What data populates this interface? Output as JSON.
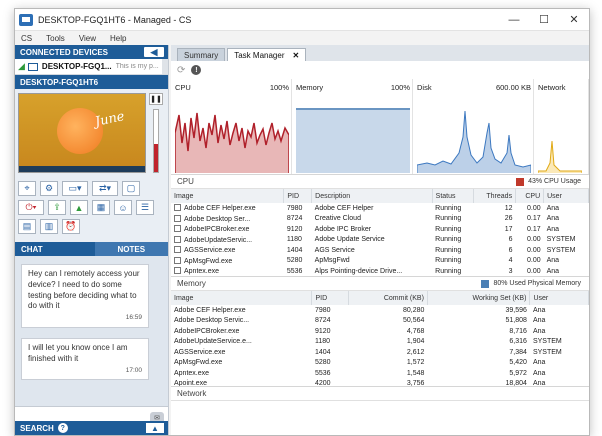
{
  "window": {
    "title": "DESKTOP-FGQ1HT6 - Managed - CS",
    "controls": [
      "—",
      "☐",
      "✕"
    ]
  },
  "menu": [
    "CS",
    "Tools",
    "View",
    "Help"
  ],
  "left": {
    "connected_header": "CONNECTED DEVICES",
    "device_name": "DESKTOP-FGQ1...",
    "device_message": "This is my p...",
    "selected_header": "DESKTOP-FGQ1HT6",
    "thumbnail_text": "June",
    "audio_level": 0.45,
    "chat_tab": "CHAT",
    "notes_tab": "NOTES",
    "messages": [
      {
        "text": "Hey can I remotely access your device? I need to do some testing before deciding what to do with it",
        "time": "16:59"
      },
      {
        "text": "I will let you know once I am finished with it",
        "time": "17:00"
      }
    ],
    "search_header": "SEARCH"
  },
  "tabs": [
    {
      "label": "Summary"
    },
    {
      "label": "Task Manager"
    }
  ],
  "graphs": {
    "cpu": {
      "label": "CPU",
      "max": "100%"
    },
    "memory": {
      "label": "Memory",
      "max": "100%"
    },
    "disk": {
      "label": "Disk",
      "max": "600.00 KB"
    },
    "network": {
      "label": "Network",
      "max": ""
    }
  },
  "cpu_section": {
    "title": "CPU",
    "legend": "43% CPU Usage",
    "color": "#c0392b",
    "columns": [
      "Image",
      "PID",
      "Description",
      "Status",
      "Threads",
      "CPU",
      "User"
    ],
    "rows": [
      [
        "Adobe CEF Helper.exe",
        "7980",
        "Adobe CEF Helper",
        "Running",
        "12",
        "0.00",
        "Ana"
      ],
      [
        "Adobe Desktop Ser...",
        "8724",
        "Creative Cloud",
        "Running",
        "26",
        "0.17",
        "Ana"
      ],
      [
        "AdobeIPCBroker.exe",
        "9120",
        "Adobe IPC Broker",
        "Running",
        "17",
        "0.17",
        "Ana"
      ],
      [
        "AdobeUpdateServic...",
        "1180",
        "Adobe Update Service",
        "Running",
        "6",
        "0.00",
        "SYSTEM"
      ],
      [
        "AGSService.exe",
        "1404",
        "AGS Service",
        "Running",
        "6",
        "0.00",
        "SYSTEM"
      ],
      [
        "ApMsgFwd.exe",
        "5280",
        "ApMsgFwd",
        "Running",
        "4",
        "0.00",
        "Ana"
      ],
      [
        "Apntex.exe",
        "5536",
        "Alps Pointing-device Drive...",
        "Running",
        "3",
        "0.00",
        "Ana"
      ],
      [
        "Apoint.exe",
        "4200",
        "Alps Pointing-device Drive...",
        "Running",
        "3",
        "0.00",
        "Ana"
      ]
    ]
  },
  "memory_section": {
    "title": "Memory",
    "legend": "80% Used Physical Memory",
    "color": "#4a7fb5",
    "columns": [
      "Image",
      "PID",
      "Commit (KB)",
      "Working Set (KB)",
      "User"
    ],
    "rows": [
      [
        "Adobe CEF Helper.exe",
        "7980",
        "80,280",
        "39,596",
        "Ana"
      ],
      [
        "Adobe Desktop Servic...",
        "8724",
        "50,564",
        "51,808",
        "Ana"
      ],
      [
        "AdobeIPCBroker.exe",
        "9120",
        "4,768",
        "8,716",
        "Ana"
      ],
      [
        "AdobeUpdateService.e...",
        "1180",
        "1,904",
        "6,316",
        "SYSTEM"
      ],
      [
        "AGSService.exe",
        "1404",
        "2,612",
        "7,384",
        "SYSTEM"
      ],
      [
        "ApMsgFwd.exe",
        "5280",
        "1,572",
        "5,420",
        "Ana"
      ],
      [
        "Apntex.exe",
        "5536",
        "1,548",
        "5,972",
        "Ana"
      ],
      [
        "Apoint.exe",
        "4200",
        "3,756",
        "18,804",
        "Ana"
      ]
    ]
  },
  "network_section": {
    "title": "Network"
  }
}
